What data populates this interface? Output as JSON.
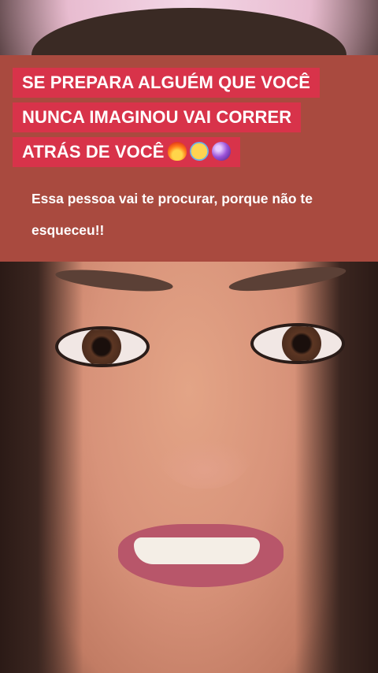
{
  "caption": {
    "headline_lines": [
      "SE PREPARA ALGUÉM QUE VOCÊ",
      "NUNCA  IMAGINOU VAI CORRER",
      "ATRÁS DE VOCÊ"
    ],
    "headline_emojis": [
      "fire-emoji",
      "screaming-face-emoji",
      "crystal-ball-emoji"
    ],
    "subtitle": "Essa pessoa vai te procurar, porque não te esqueceu!!"
  },
  "colors": {
    "panel": "#a94a3f",
    "headline_bg": "#d8334a",
    "text": "#ffffff"
  }
}
